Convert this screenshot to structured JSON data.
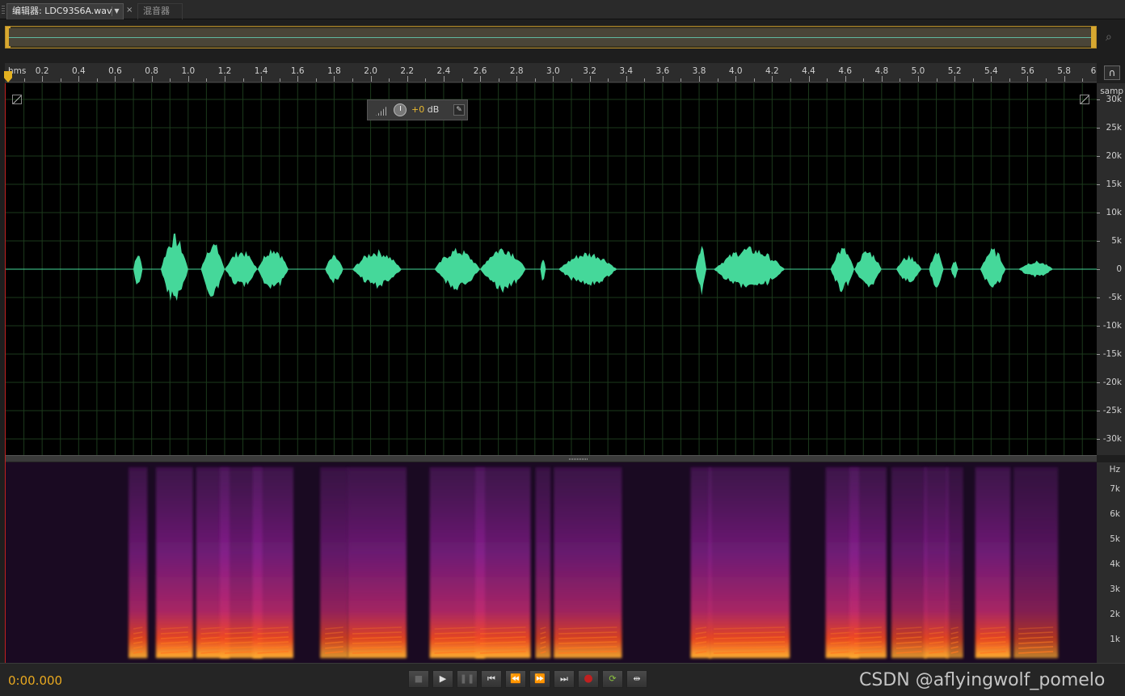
{
  "tabs": {
    "editor_label": "编辑器: LDC93S6A.wav",
    "editor_dropdown": "▼",
    "close": "×",
    "mixer_label": "混音器"
  },
  "overview": {
    "zoom_icon": "magnifier-icon"
  },
  "ruler": {
    "unit": "hms",
    "ticks": [
      "0.2",
      "0.4",
      "0.6",
      "0.8",
      "1.0",
      "1.2",
      "1.4",
      "1.6",
      "1.8",
      "2.0",
      "2.2",
      "2.4",
      "2.6",
      "2.8",
      "3.0",
      "3.2",
      "3.4",
      "3.6",
      "3.8",
      "4.0",
      "4.2",
      "4.4",
      "4.6",
      "4.8",
      "5.0",
      "5.2",
      "5.4",
      "5.6",
      "5.8"
    ],
    "end_label": "6"
  },
  "hud": {
    "gain_value": "+0",
    "gain_unit": " dB"
  },
  "amplitude_scale": {
    "title": "samp",
    "labels": [
      "30k",
      "25k",
      "20k",
      "15k",
      "10k",
      "5k",
      "0",
      "-5k",
      "-10k",
      "-15k",
      "-20k",
      "-25k",
      "-30k"
    ]
  },
  "frequency_scale": {
    "title": "Hz",
    "labels": [
      "7k",
      "6k",
      "5k",
      "4k",
      "3k",
      "2k",
      "1k"
    ]
  },
  "transport": {
    "time": "0:00.000",
    "buttons": [
      {
        "name": "stop-button",
        "glyph": "■",
        "state": "disabled"
      },
      {
        "name": "play-button",
        "glyph": "▶",
        "state": "normal"
      },
      {
        "name": "pause-button",
        "glyph": "❚❚",
        "state": "disabled"
      },
      {
        "name": "go-to-start-button",
        "glyph": "⏮",
        "state": "normal"
      },
      {
        "name": "rewind-button",
        "glyph": "⏪",
        "state": "normal"
      },
      {
        "name": "fast-forward-button",
        "glyph": "⏩",
        "state": "normal"
      },
      {
        "name": "go-to-end-button",
        "glyph": "⏭",
        "state": "normal"
      },
      {
        "name": "record-button",
        "glyph": "●",
        "state": "rec"
      },
      {
        "name": "loop-button",
        "glyph": "⟳",
        "state": "loop"
      },
      {
        "name": "skip-selection-button",
        "glyph": "⇹",
        "state": "normal"
      }
    ]
  },
  "watermark": "CSDN @aflyingwolf_pomelo",
  "colors": {
    "waveform": "#45d89a",
    "accent": "#e8a820",
    "grid": "#1c3a1c"
  },
  "speech_segments": [
    [
      0.7,
      0.75,
      0.4
    ],
    [
      0.85,
      1.0,
      0.75
    ],
    [
      1.07,
      1.2,
      0.6
    ],
    [
      1.2,
      1.38,
      0.42
    ],
    [
      1.38,
      1.55,
      0.5
    ],
    [
      1.75,
      1.85,
      0.3
    ],
    [
      1.9,
      2.17,
      0.42
    ],
    [
      2.35,
      2.6,
      0.45
    ],
    [
      2.6,
      2.85,
      0.5
    ],
    [
      2.93,
      2.96,
      0.3
    ],
    [
      3.03,
      3.35,
      0.38
    ],
    [
      3.78,
      3.84,
      0.55
    ],
    [
      3.88,
      4.27,
      0.48
    ],
    [
      4.52,
      4.65,
      0.48
    ],
    [
      4.65,
      4.8,
      0.42
    ],
    [
      4.88,
      5.02,
      0.3
    ],
    [
      5.06,
      5.14,
      0.42
    ],
    [
      5.18,
      5.22,
      0.2
    ],
    [
      5.34,
      5.48,
      0.45
    ],
    [
      5.55,
      5.74,
      0.18
    ]
  ]
}
